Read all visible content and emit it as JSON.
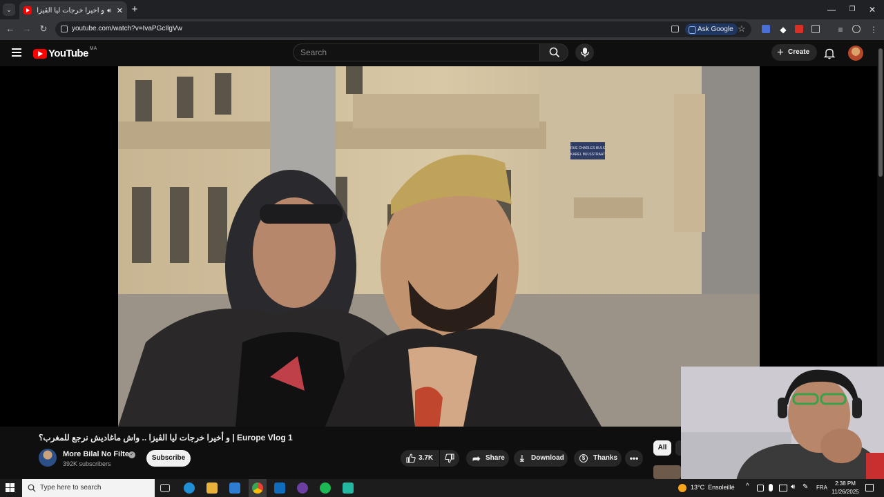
{
  "browser": {
    "tab_title": "و أخيرا خرجات ليا الڤيزا .. واش",
    "url": "youtube.com/watch?v=IvaPGcIlgVw",
    "ask_google_label": "Ask Google"
  },
  "youtube": {
    "logo_text": "YouTube",
    "country_code": "MA",
    "search_placeholder": "Search",
    "create_label": "Create"
  },
  "video": {
    "title": "و أخيرا خرجات ليا الڤيزا .. واش ماغاديش نرجع للمغرب؟ | Europe Vlog 1",
    "sign_lines": [
      "RUE CHARLES BULS",
      "KAREL BULSSTRAAT"
    ]
  },
  "channel": {
    "name": "More Bilal No Filter",
    "subscribers": "392K subscribers",
    "subscribe_label": "Subscribe"
  },
  "actions": {
    "like_count": "3.7K",
    "share_label": "Share",
    "download_label": "Download",
    "thanks_label": "Thanks"
  },
  "sidebar": {
    "chip_all": "All"
  },
  "taskbar": {
    "search_placeholder": "Type here to search",
    "temperature": "13°C",
    "weather": "Ensoleillé",
    "language": "FRA",
    "time": "2:38 PM",
    "date": "11/26/2025"
  },
  "colors": {
    "youtube_red": "#ff0000",
    "background": "#0f0f0f",
    "chrome_dark": "#202124"
  }
}
